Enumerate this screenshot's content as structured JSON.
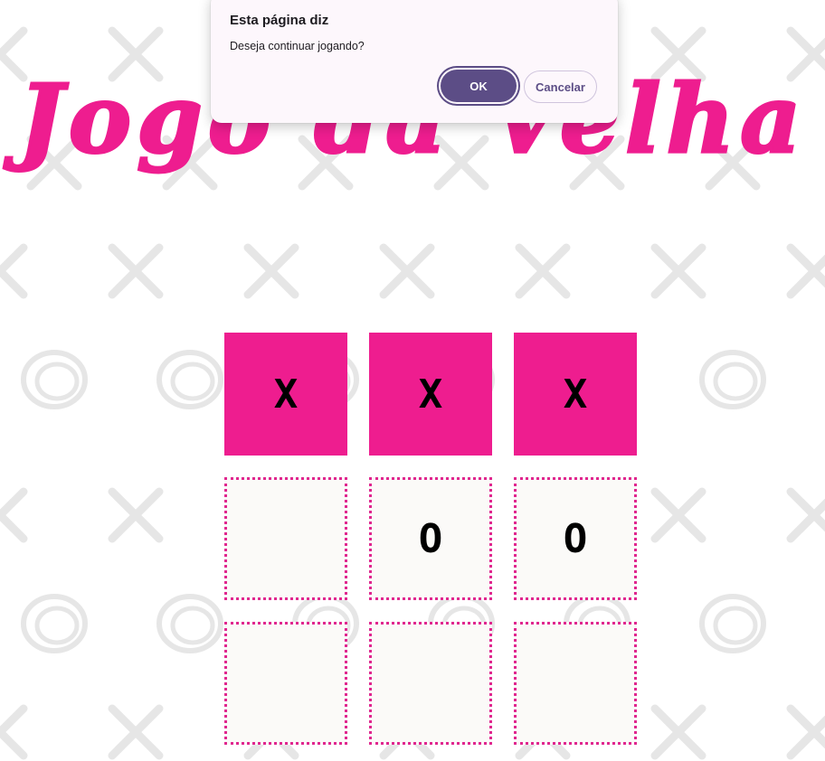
{
  "game": {
    "title": "Jogo da Velha",
    "board": [
      [
        "X",
        "X",
        "X"
      ],
      [
        "",
        "O",
        "O"
      ],
      [
        "",
        "",
        ""
      ]
    ]
  },
  "dialog": {
    "title": "Esta página diz",
    "message": "Deseja continuar jogando?",
    "ok_label": "OK",
    "cancel_label": "Cancelar"
  },
  "colors": {
    "accent": "#ee1d8f",
    "dialog_primary": "#5c4d86",
    "background_marks": "#e6e6e6"
  },
  "background": {
    "pattern_icons": [
      "x-doodle-icon",
      "o-doodle-icon"
    ]
  }
}
